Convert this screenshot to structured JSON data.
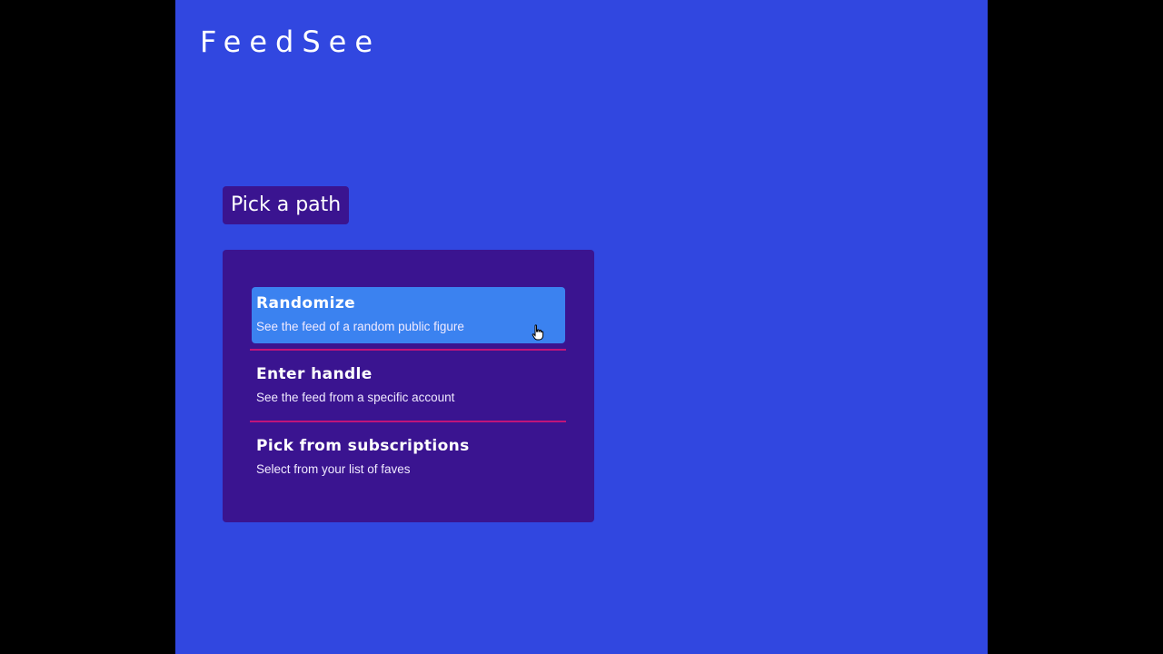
{
  "app": {
    "logo": "FeedSee"
  },
  "heading": "Pick a path",
  "options": [
    {
      "title": "Randomize",
      "subtitle": "See the feed of a random public figure"
    },
    {
      "title": "Enter handle",
      "subtitle": "See the feed from a specific account"
    },
    {
      "title": "Pick from subscriptions",
      "subtitle": "Select from your list of faves"
    }
  ],
  "colors": {
    "page_background": "#3147e0",
    "panel_background": "#3a1490",
    "active_option": "#3b82f0",
    "divider": "#c0157a",
    "outer_background": "#000000"
  }
}
